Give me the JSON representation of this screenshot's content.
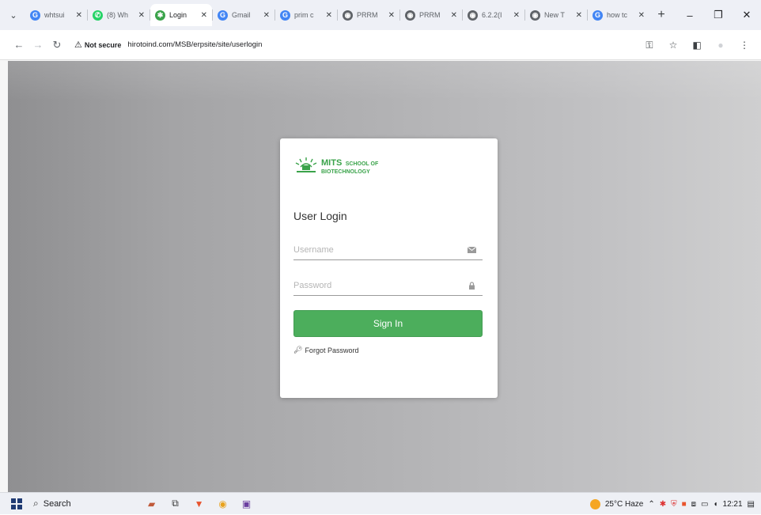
{
  "browser": {
    "tabs": [
      {
        "label": "whtsui",
        "favicon": "google-icon",
        "favicon_color": "#4285f4",
        "favicon_char": "G",
        "active": false
      },
      {
        "label": "(8) Wh",
        "favicon": "whatsapp-icon",
        "favicon_color": "#25d366",
        "favicon_char": "✆",
        "active": false
      },
      {
        "label": "Login",
        "favicon": "mits-logo-icon",
        "favicon_color": "#3aa34a",
        "favicon_char": "✱",
        "active": true
      },
      {
        "label": "Gmail",
        "favicon": "google-icon",
        "favicon_color": "#4285f4",
        "favicon_char": "G",
        "active": false
      },
      {
        "label": "prim c",
        "favicon": "google-icon",
        "favicon_color": "#4285f4",
        "favicon_char": "G",
        "active": false
      },
      {
        "label": "PRRM",
        "favicon": "globe-icon",
        "favicon_color": "#5f6368",
        "favicon_char": "◉",
        "active": false
      },
      {
        "label": "PRRM",
        "favicon": "globe-icon",
        "favicon_color": "#5f6368",
        "favicon_char": "◉",
        "active": false
      },
      {
        "label": "6.2.2(I",
        "favicon": "globe-icon",
        "favicon_color": "#5f6368",
        "favicon_char": "◉",
        "active": false
      },
      {
        "label": "New T",
        "favicon": "chrome-icon",
        "favicon_color": "#5f6368",
        "favicon_char": "◉",
        "active": false
      },
      {
        "label": "how tc",
        "favicon": "google-icon",
        "favicon_color": "#4285f4",
        "favicon_char": "G",
        "active": false
      }
    ],
    "new_tab": "+",
    "not_secure": "Not secure",
    "url": "hirotoind.com/MSB/erpsite/site/userlogin"
  },
  "login": {
    "brand_mits": "MITS",
    "brand_school": "SCHOOL OF",
    "brand_bio": "BIOTECHNOLOGY",
    "title": "User Login",
    "username_placeholder": "Username",
    "password_placeholder": "Password",
    "signin_label": "Sign In",
    "forgot_label": "Forgot Password"
  },
  "taskbar": {
    "search_label": "Search",
    "weather": "25°C Haze",
    "time": "12:21"
  },
  "colors": {
    "accent_green": "#4cae5c",
    "brand_green": "#3aa34a"
  }
}
